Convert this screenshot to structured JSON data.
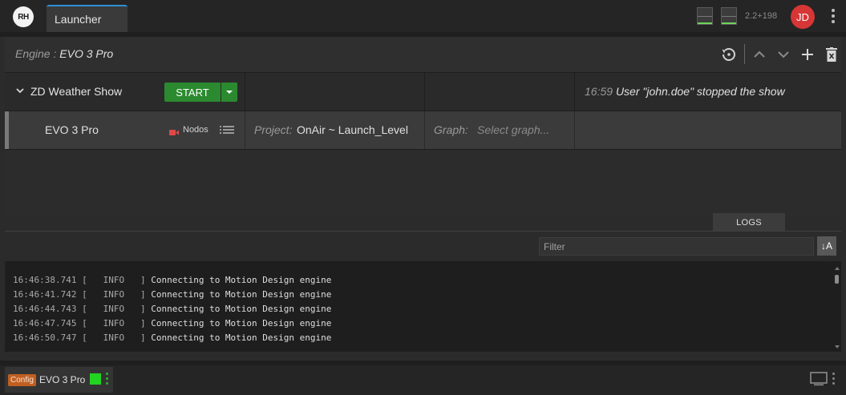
{
  "app": {
    "logo_text": "RH",
    "tab_label": "Launcher",
    "version": "2.2+198",
    "user_initials": "JD",
    "colors": {
      "accent": "#2e8fd6",
      "start": "#2b8a2f",
      "avatar": "#d73636",
      "config": "#c15f22",
      "status_ok": "#22d321"
    }
  },
  "engine_header": {
    "prefix": "Engine : ",
    "name": "EVO 3 Pro"
  },
  "show": {
    "name": "ZD Weather Show",
    "start_label": "START",
    "status_time": "16:59",
    "status_text": "User \"john.doe\" stopped the show"
  },
  "engine_row": {
    "name": "EVO 3 Pro",
    "renderer": "Nodos",
    "project_label": "Project:",
    "project_value": "OnAir ~ Launch_Level",
    "graph_label": "Graph:",
    "graph_placeholder": "Select graph..."
  },
  "logs": {
    "tab_label": "LOGS",
    "filter_placeholder": "Filter",
    "sort_label": "↓A",
    "lines": [
      {
        "ts": "16:46:38.741",
        "level": "[   INFO   ]",
        "msg": "Connecting to Motion Design engine"
      },
      {
        "ts": "16:46:41.742",
        "level": "[   INFO   ]",
        "msg": "Connecting to Motion Design engine"
      },
      {
        "ts": "16:46:44.743",
        "level": "[   INFO   ]",
        "msg": "Connecting to Motion Design engine"
      },
      {
        "ts": "16:46:47.745",
        "level": "[   INFO   ]",
        "msg": "Connecting to Motion Design engine"
      },
      {
        "ts": "16:46:50.747",
        "level": "[   INFO   ]",
        "msg": "Connecting to Motion Design engine"
      }
    ]
  },
  "bottom": {
    "config_label": "Config",
    "engine_name": "EVO 3 Pro"
  }
}
